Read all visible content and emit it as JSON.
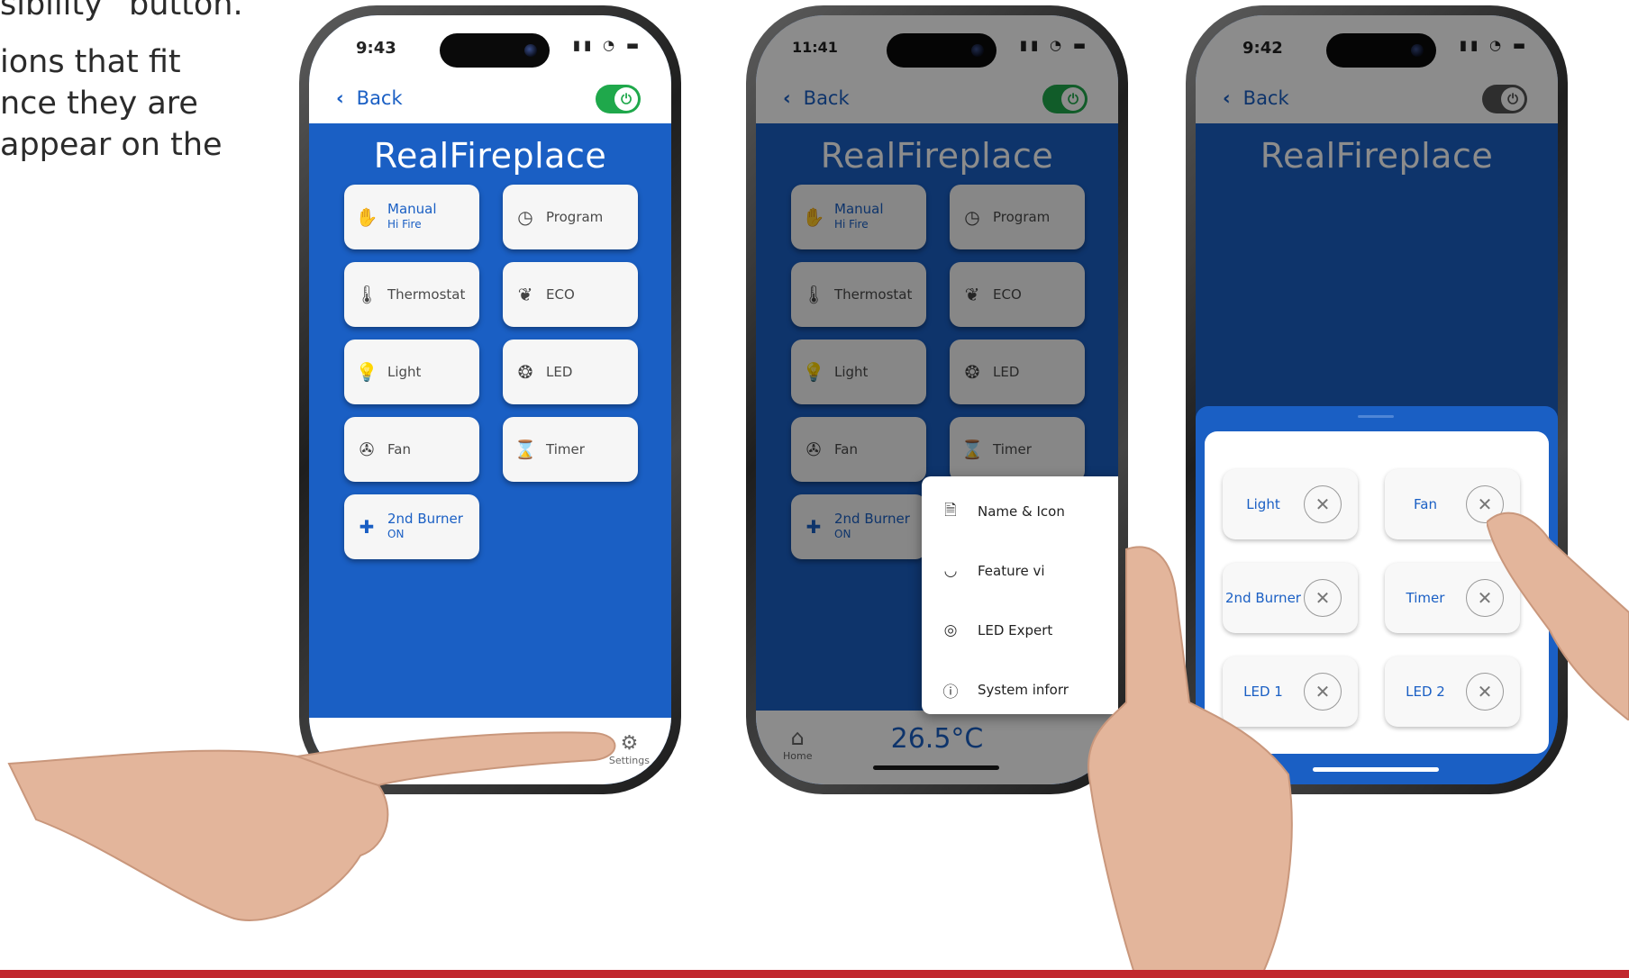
{
  "intro": {
    "line0": "sibility” button.",
    "line1": "ions that fit",
    "line2": "nce they are",
    "line3": "appear on the"
  },
  "colors": {
    "accent": "#1a5fc4",
    "toggle_on": "#1fa84b",
    "footer_bar": "#c1272d"
  },
  "phone1": {
    "time": "9:43",
    "back": "Back",
    "brand": "RealFireplace",
    "tiles": [
      {
        "label": "Manual",
        "sub": "Hi Fire",
        "icon": "hand-icon"
      },
      {
        "label": "Program",
        "sub": "",
        "icon": "clock-icon"
      },
      {
        "label": "Thermostat",
        "sub": "",
        "icon": "thermometer-icon"
      },
      {
        "label": "ECO",
        "sub": "",
        "icon": "leaf-icon"
      },
      {
        "label": "Light",
        "sub": "",
        "icon": "bulb-icon"
      },
      {
        "label": "LED",
        "sub": "",
        "icon": "led-icon"
      },
      {
        "label": "Fan",
        "sub": "",
        "icon": "fan-icon"
      },
      {
        "label": "Timer",
        "sub": "",
        "icon": "hourglass-icon"
      },
      {
        "label": "2nd Burner",
        "sub": "ON",
        "icon": "plus-icon"
      }
    ],
    "settings": "Settings"
  },
  "phone2": {
    "time": "11:41",
    "back": "Back",
    "brand": "RealFireplace",
    "tiles": [
      {
        "label": "Manual",
        "sub": "Hi Fire"
      },
      {
        "label": "Program",
        "sub": ""
      },
      {
        "label": "Thermostat",
        "sub": ""
      },
      {
        "label": "ECO",
        "sub": ""
      },
      {
        "label": "Light",
        "sub": ""
      },
      {
        "label": "LED",
        "sub": ""
      },
      {
        "label": "Fan",
        "sub": ""
      },
      {
        "label": "Timer",
        "sub": ""
      },
      {
        "label": "2nd Burner",
        "sub": "ON"
      }
    ],
    "menu": [
      {
        "label": "Name & Icon",
        "icon": "document-icon"
      },
      {
        "label": "Feature vi",
        "icon": "closed-eye-icon"
      },
      {
        "label": "LED Expert",
        "icon": "eye-icon"
      },
      {
        "label": "System inforr",
        "icon": "info-icon"
      }
    ],
    "home": "Home",
    "temperature": "26.5°C"
  },
  "phone3": {
    "time": "9:42",
    "back": "Back",
    "brand": "RealFireplace",
    "chips": [
      {
        "label": "Light"
      },
      {
        "label": "Fan"
      },
      {
        "label": "2nd Burner"
      },
      {
        "label": "Timer"
      },
      {
        "label": "LED 1"
      },
      {
        "label": "LED 2"
      }
    ]
  }
}
